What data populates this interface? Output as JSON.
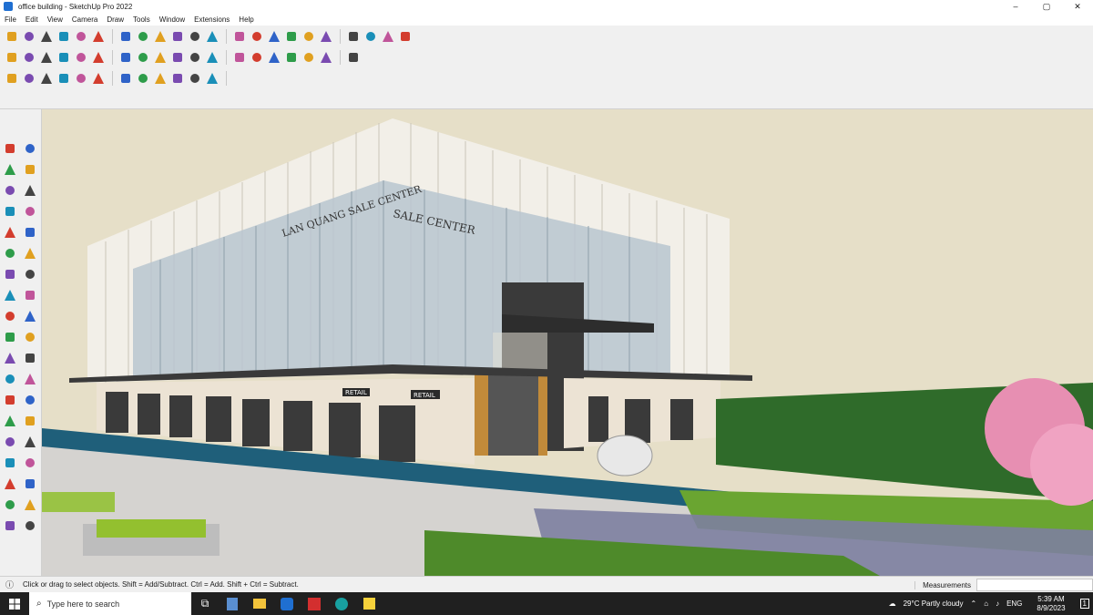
{
  "window": {
    "title": "office building - SketchUp Pro 2022",
    "controls": {
      "minimize": "–",
      "maximize": "▢",
      "close": "✕"
    }
  },
  "menu": [
    "File",
    "Edit",
    "View",
    "Camera",
    "Draw",
    "Tools",
    "Window",
    "Extensions",
    "Help"
  ],
  "scene": {
    "facade_sign_1": "LAN QUANG SALE CENTER",
    "facade_sign_2": "SALE CENTER",
    "retail_sign": "RETAIL",
    "entrance_sign": "SALE CENTER"
  },
  "status": {
    "hint": "Click or drag to select objects. Shift = Add/Subtract. Ctrl = Add. Shift + Ctrl = Subtract.",
    "measurements_label": "Measurements",
    "measurements_value": ""
  },
  "taskbar": {
    "search_placeholder": "Type here to search",
    "weather": "29°C  Partly cloudy",
    "lang": "ENG",
    "time": "5:39 AM",
    "date": "8/9/2023",
    "notifications": "1"
  },
  "colors": {
    "sky": "#e6dfc8",
    "glass": "#b9c6cf",
    "fins": "#f2efe8",
    "water": "#1f5f7a",
    "lawn": "#6aa531",
    "blossom": "#e78fb2",
    "accent": "#1f6fd1"
  },
  "icons": {
    "toolbar_row1": [
      "zoom-tool-icon",
      "select-tool-icon",
      "eraser-tool-icon",
      "line-tool-icon",
      "arc-tool-icon",
      "rectangle-tool-icon",
      "push-pull-tool-icon",
      "follow-me-tool-icon",
      "move-tool-icon",
      "rotate-tool-icon",
      "scale-tool-icon",
      "tape-measure-icon",
      "text-tool-icon",
      "paint-bucket-icon",
      "orbit-icon",
      "pan-icon",
      "zoom-icon",
      "zoom-extents-icon",
      "warehouse-icon",
      "extension-icon",
      "section-plane-icon",
      "user-icon"
    ],
    "toolbar_row2": [
      "iso-view-icon",
      "top-view-icon",
      "front-view-icon",
      "right-view-icon",
      "back-view-icon",
      "left-view-icon",
      "xray-icon",
      "back-edges-icon",
      "wireframe-icon",
      "hidden-line-icon",
      "shaded-icon",
      "textured-icon",
      "monochrome-icon",
      "solid-union-icon",
      "solid-subtract-icon",
      "solid-trim-icon",
      "sandbox-icon",
      "shadow-icon",
      "fog-icon"
    ],
    "toolbar_row3": [
      "flip-icon",
      "curve-icon",
      "weld-icon",
      "bezier-icon",
      "offset-icon",
      "split-icon",
      "loft-icon",
      "extrude-icon",
      "shape-bender-icon",
      "round-corner-icon",
      "joint-pushpull-icon",
      "tools-on-surface-icon"
    ],
    "left_toolbar": [
      "select-icon",
      "orbit-icon",
      "paint-icon",
      "eraser-icon",
      "component-icon",
      "tag-icon",
      "line-icon",
      "freehand-icon",
      "rectangle-icon",
      "rotated-rect-icon",
      "circle-icon",
      "polygon-icon",
      "arc-icon",
      "pie-icon",
      "move-icon",
      "pushpull-icon",
      "rotate-icon",
      "followme-icon",
      "scale-icon",
      "offset-icon",
      "tape-icon",
      "dimension-icon",
      "protractor-icon",
      "text-icon",
      "axes-icon",
      "3dtext-icon",
      "orbit-view-icon",
      "pan-view-icon",
      "zoom-view-icon",
      "zoom-window-icon",
      "zoom-extents-icon",
      "previous-view-icon",
      "walk-icon",
      "look-around-icon",
      "position-camera-icon",
      "section-icon",
      "sandbox-icon",
      "layers-icon"
    ]
  }
}
